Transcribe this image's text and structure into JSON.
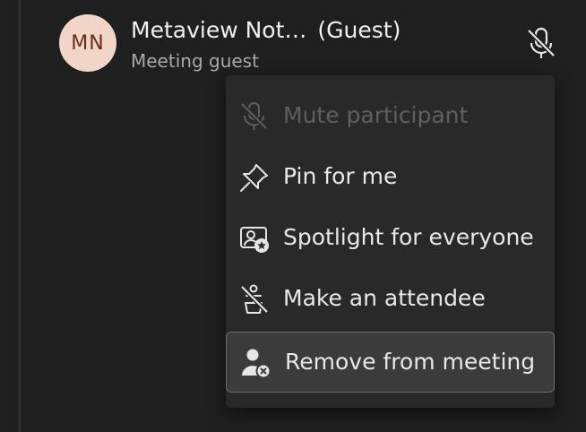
{
  "participant": {
    "initials": "MN",
    "name": "Metaview Not…",
    "role_tag": "(Guest)",
    "subtitle": "Meeting guest",
    "mic_icon": "mic-off-icon",
    "avatar_bg": "#f1d5c9",
    "avatar_fg": "#6b2b1f"
  },
  "menu": {
    "items": [
      {
        "label": "Mute participant",
        "icon": "mic-off-icon",
        "disabled": true
      },
      {
        "label": "Pin for me",
        "icon": "pin-icon",
        "disabled": false
      },
      {
        "label": "Spotlight for everyone",
        "icon": "spotlight-icon",
        "disabled": false
      },
      {
        "label": "Make an attendee",
        "icon": "presenter-off-icon",
        "disabled": false
      },
      {
        "label": "Remove from meeting",
        "icon": "remove-person-icon",
        "disabled": false,
        "highlighted": true
      }
    ]
  }
}
